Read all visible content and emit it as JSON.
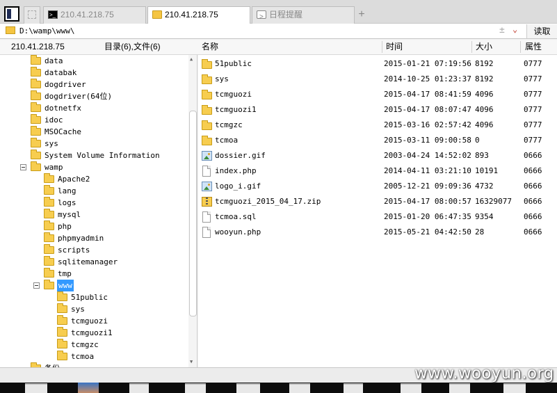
{
  "tabs": [
    {
      "label": "210.41.218.75",
      "icon": "terminal-icon",
      "active": false
    },
    {
      "label": "210.41.218.75",
      "icon": "folder-icon",
      "active": true
    },
    {
      "label": "日程提醒",
      "icon": "schedule-icon",
      "active": false
    }
  ],
  "add_tab_label": "+",
  "address": {
    "value": "D:\\wamp\\www\\",
    "plus": "±",
    "dropdown": "⌄",
    "read_button": "读取"
  },
  "header": {
    "host": "210.41.218.75",
    "summary": "目录(6),文件(6)",
    "columns": {
      "name": "名称",
      "time": "时间",
      "size": "大小",
      "attr": "属性"
    }
  },
  "tree": [
    {
      "label": "data",
      "level": 1
    },
    {
      "label": "databak",
      "level": 1
    },
    {
      "label": "dogdriver",
      "level": 1
    },
    {
      "label": "dogdriver(64位)",
      "level": 1
    },
    {
      "label": "dotnetfx",
      "level": 1
    },
    {
      "label": "idoc",
      "level": 1
    },
    {
      "label": "MSOCache",
      "level": 1
    },
    {
      "label": "sys",
      "level": 1
    },
    {
      "label": "System Volume Information",
      "level": 1
    },
    {
      "label": "wamp",
      "level": 1,
      "expanded": true
    },
    {
      "label": "Apache2",
      "level": 2
    },
    {
      "label": "lang",
      "level": 2
    },
    {
      "label": "logs",
      "level": 2
    },
    {
      "label": "mysql",
      "level": 2
    },
    {
      "label": "php",
      "level": 2
    },
    {
      "label": "phpmyadmin",
      "level": 2
    },
    {
      "label": "scripts",
      "level": 2
    },
    {
      "label": "sqlitemanager",
      "level": 2
    },
    {
      "label": "tmp",
      "level": 2
    },
    {
      "label": "www",
      "level": 2,
      "expanded": true,
      "selected": true
    },
    {
      "label": "51public",
      "level": 3
    },
    {
      "label": "sys",
      "level": 3
    },
    {
      "label": "tcmguozi",
      "level": 3
    },
    {
      "label": "tcmguozi1",
      "level": 3
    },
    {
      "label": "tcmgzc",
      "level": 3
    },
    {
      "label": "tcmoa",
      "level": 3
    },
    {
      "label": "备份",
      "level": 1
    }
  ],
  "files": [
    {
      "name": "51public",
      "time": "2015-01-21 07:19:56",
      "size": "8192",
      "attr": "0777",
      "icon": "folder"
    },
    {
      "name": "sys",
      "time": "2014-10-25 01:23:37",
      "size": "8192",
      "attr": "0777",
      "icon": "folder"
    },
    {
      "name": "tcmguozi",
      "time": "2015-04-17 08:41:59",
      "size": "4096",
      "attr": "0777",
      "icon": "folder"
    },
    {
      "name": "tcmguozi1",
      "time": "2015-04-17 08:07:47",
      "size": "4096",
      "attr": "0777",
      "icon": "folder"
    },
    {
      "name": "tcmgzc",
      "time": "2015-03-16 02:57:42",
      "size": "4096",
      "attr": "0777",
      "icon": "folder"
    },
    {
      "name": "tcmoa",
      "time": "2015-03-11 09:00:58",
      "size": "0",
      "attr": "0777",
      "icon": "folder"
    },
    {
      "name": "dossier.gif",
      "time": "2003-04-24 14:52:02",
      "size": "893",
      "attr": "0666",
      "icon": "image"
    },
    {
      "name": "index.php",
      "time": "2014-04-11 03:21:10",
      "size": "10191",
      "attr": "0666",
      "icon": "doc"
    },
    {
      "name": "logo_i.gif",
      "time": "2005-12-21 09:09:36",
      "size": "4732",
      "attr": "0666",
      "icon": "image"
    },
    {
      "name": "tcmguozi_2015_04_17.zip",
      "time": "2015-04-17 08:00:57",
      "size": "16329077",
      "attr": "0666",
      "icon": "zip"
    },
    {
      "name": "tcmoa.sql",
      "time": "2015-01-20 06:47:35",
      "size": "9354",
      "attr": "0666",
      "icon": "doc"
    },
    {
      "name": "wooyun.php",
      "time": "2015-05-21 04:42:50",
      "size": "28",
      "attr": "0666",
      "icon": "doc"
    }
  ],
  "watermark": "www.wooyun.org",
  "colors": {
    "selection": "#3399ff",
    "folder": "#f7cd4f",
    "dropdown": "#c0392b"
  }
}
